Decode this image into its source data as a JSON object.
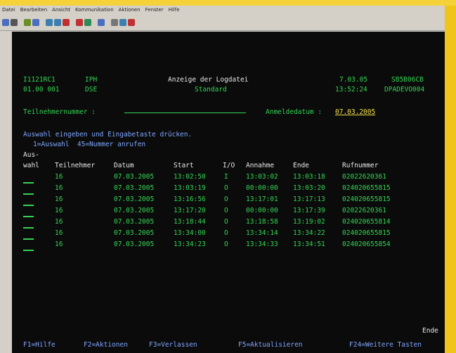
{
  "menu": [
    "Datei",
    "Bearbeiten",
    "Ansicht",
    "Kommunikation",
    "Aktionen",
    "Fenster",
    "Hilfe"
  ],
  "toolbar_icons": [
    {
      "name": "save-icon",
      "color": "#4a6fbf"
    },
    {
      "name": "print-icon",
      "color": "#555555"
    },
    {
      "name": "copy-icon",
      "color": "#6b8e23"
    },
    {
      "name": "paste-icon",
      "color": "#4a6fbf"
    },
    {
      "name": "receive-icon",
      "color": "#3a7fb0"
    },
    {
      "name": "send-icon",
      "color": "#3a7fb0"
    },
    {
      "name": "macro-icon",
      "color": "#c03030"
    },
    {
      "name": "record-icon",
      "color": "#c03030"
    },
    {
      "name": "play-icon",
      "color": "#2e8b57"
    },
    {
      "name": "map-icon",
      "color": "#4a6fbf"
    },
    {
      "name": "keyboard-icon",
      "color": "#777777"
    },
    {
      "name": "help-icon",
      "color": "#3a7fb0"
    },
    {
      "name": "color-icon",
      "color": "#c03030"
    }
  ],
  "header": {
    "left1": "I1121RC1",
    "left2": "01.00 001",
    "code1": "IPH",
    "code2": "DSE",
    "title": "Anzeige der Logdatei",
    "subtitle": "Standard",
    "date": "7.03.05",
    "time": "13:52:24",
    "sys1": "SB5B06CB",
    "sys2": "DPADEVO004"
  },
  "fields": {
    "participant_label": "Teilnehmernummer :",
    "signon_label": "Anmeldedatum :",
    "signon_value": "07.03.2005"
  },
  "instructions": {
    "line1": "Auswahl eingeben und Eingabetaste drücken.",
    "line2": "1=Auswahl  45=Nummer anrufen"
  },
  "columns": {
    "opt_top": "Aus-",
    "opt": "wahl",
    "participant": "Teilnehmer",
    "date": "Datum",
    "start": "Start",
    "io": "I/O",
    "accept": "Annahme",
    "end": "Ende",
    "number": "Rufnummer"
  },
  "rows": [
    {
      "opt": "_",
      "participant": "16",
      "date": "07.03.2005",
      "start": "13:02:50",
      "io": "I",
      "accept": "13:03:02",
      "end": "13:03:18",
      "number": "02022620361"
    },
    {
      "opt": "_",
      "participant": "16",
      "date": "07.03.2005",
      "start": "13:03:19",
      "io": "O",
      "accept": "00:00:00",
      "end": "13:03:20",
      "number": "024020655815"
    },
    {
      "opt": "_",
      "participant": "16",
      "date": "07.03.2005",
      "start": "13:16:56",
      "io": "O",
      "accept": "13:17:01",
      "end": "13:17:13",
      "number": "024020655815"
    },
    {
      "opt": "_",
      "participant": "16",
      "date": "07.03.2005",
      "start": "13:17:20",
      "io": "O",
      "accept": "00:00:00",
      "end": "13:17:39",
      "number": "02022620361"
    },
    {
      "opt": "_",
      "participant": "16",
      "date": "07.03.2005",
      "start": "13:18:44",
      "io": "O",
      "accept": "13:18:58",
      "end": "13:19:02",
      "number": "024020655814"
    },
    {
      "opt": "_",
      "participant": "16",
      "date": "07.03.2005",
      "start": "13:34:00",
      "io": "O",
      "accept": "13:34:14",
      "end": "13:34:22",
      "number": "024020655815"
    },
    {
      "opt": "_",
      "participant": "16",
      "date": "07.03.2005",
      "start": "13:34:23",
      "io": "O",
      "accept": "13:34:33",
      "end": "13:34:51",
      "number": "024020655854"
    }
  ],
  "footer": {
    "end_label": "Ende",
    "keys": [
      "F1=Hilfe",
      "F2=Aktionen",
      "F3=Verlassen",
      "F5=Aktualisieren",
      "F24=Weitere Tasten"
    ]
  }
}
